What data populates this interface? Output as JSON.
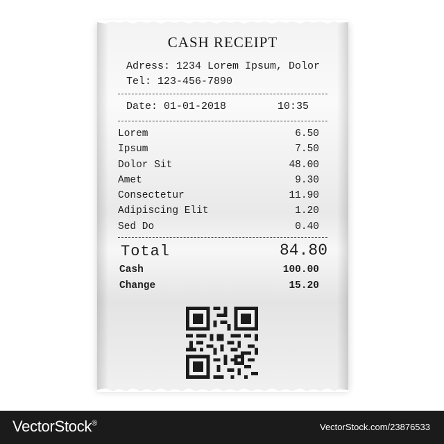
{
  "receipt": {
    "title": "CASH RECEIPT",
    "address": "Adress: 1234 Lorem Ipsum, Dolor",
    "tel": "Tel: 123-456-7890",
    "date": "Date: 01-01-2018",
    "time": "10:35",
    "items": [
      {
        "name": "Lorem",
        "price": "6.50"
      },
      {
        "name": "Ipsum",
        "price": "7.50"
      },
      {
        "name": "Dolor Sit",
        "price": "48.00"
      },
      {
        "name": "Amet",
        "price": "9.30"
      },
      {
        "name": "Consectetur",
        "price": "11.90"
      },
      {
        "name": "Adipiscing Elit",
        "price": "1.20"
      },
      {
        "name": "Sed Do",
        "price": "0.40"
      }
    ],
    "total_label": "Total",
    "total_value": "84.80",
    "cash_label": "Cash",
    "cash_value": "100.00",
    "change_label": "Change",
    "change_value": "15.20",
    "qr_icon": "qr-code-icon"
  },
  "footer": {
    "brand": "VectorStock",
    "brand_mark": "®",
    "stock_id": "VectorStock.com/23876533"
  }
}
